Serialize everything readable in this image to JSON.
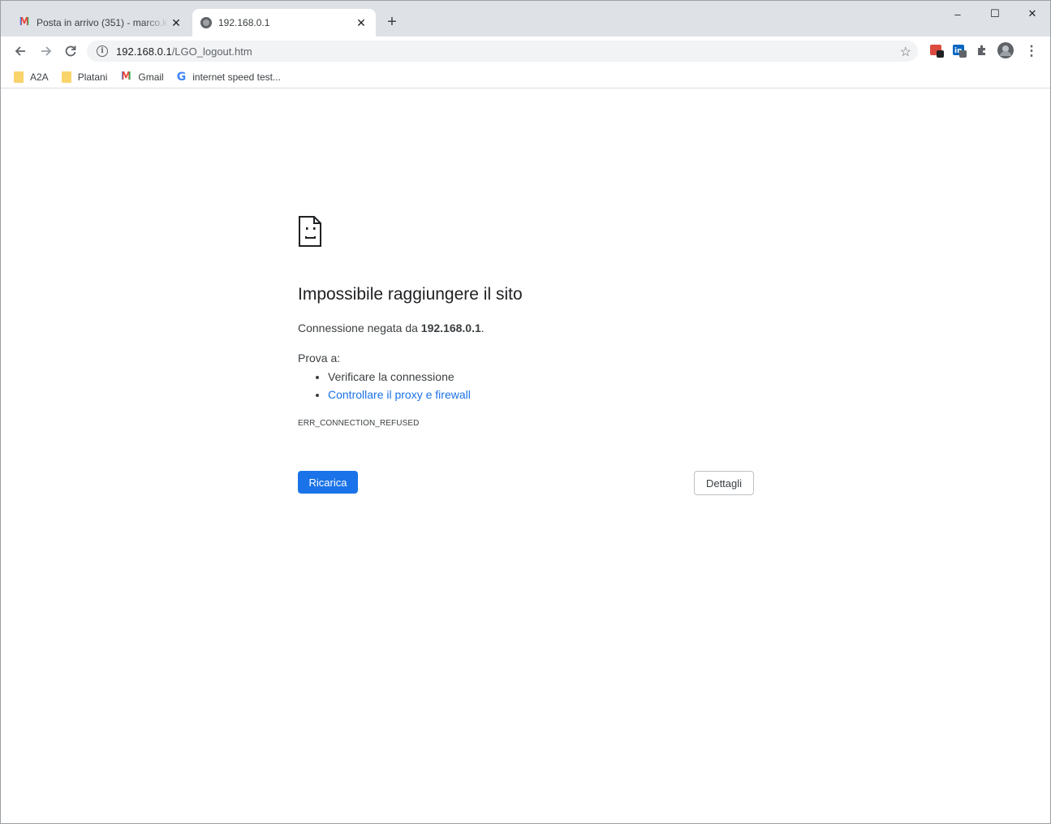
{
  "browser": {
    "tabs": [
      {
        "title": "Posta in arrivo (351) - marco.k.m",
        "icon": "gmail-icon",
        "active": false
      },
      {
        "title": "192.168.0.1",
        "icon": "globe-icon",
        "active": true
      }
    ],
    "new_tab_label": "+",
    "window_controls": {
      "minimize": "–",
      "maximize": "☐",
      "close": "✕"
    },
    "url": {
      "host": "192.168.0.1",
      "path": "/LGO_logout.htm"
    },
    "bookmarks": [
      {
        "label": "A2A",
        "icon": "folder-icon"
      },
      {
        "label": "Platani",
        "icon": "folder-icon"
      },
      {
        "label": "Gmail",
        "icon": "gmail-icon"
      },
      {
        "label": "internet speed test...",
        "icon": "google-icon"
      }
    ]
  },
  "error_page": {
    "heading": "Impossibile raggiungere il sito",
    "summary_prefix": "Connessione negata da ",
    "summary_host": "192.168.0.1",
    "summary_suffix": ".",
    "try_label": "Prova a:",
    "suggestions": [
      "Verificare la connessione",
      "Controllare il proxy e firewall"
    ],
    "error_code": "ERR_CONNECTION_REFUSED",
    "reload_button": "Ricarica",
    "details_button": "Dettagli"
  },
  "colors": {
    "accent": "#1a73e8",
    "tabstrip": "#dee1e6",
    "text": "#202124"
  }
}
